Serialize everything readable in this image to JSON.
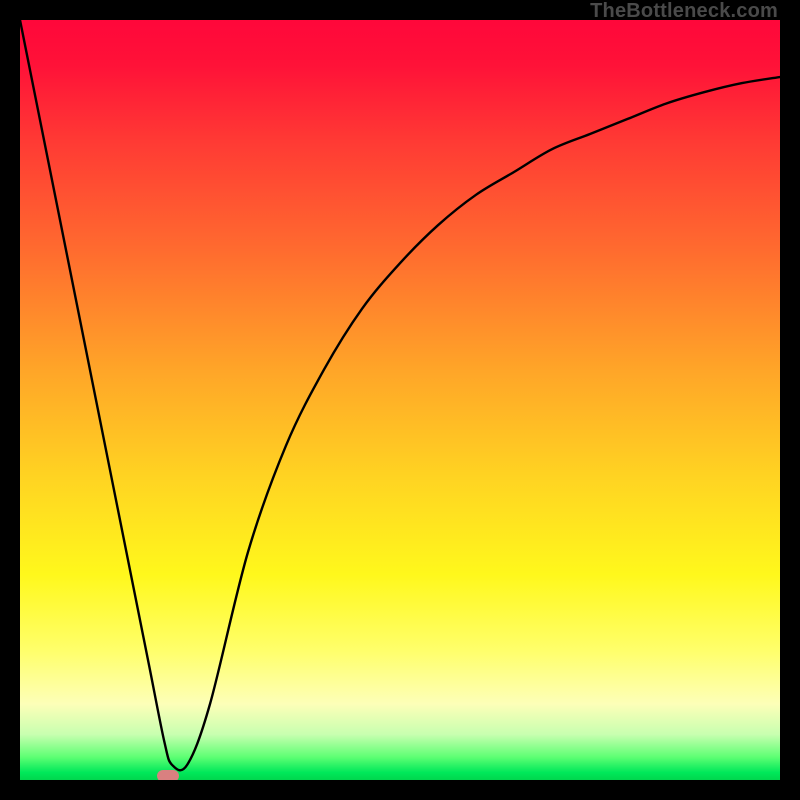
{
  "watermark": "TheBottleneck.com",
  "chart_data": {
    "type": "line",
    "title": "",
    "xlabel": "",
    "ylabel": "",
    "xlim": [
      0,
      100
    ],
    "ylim": [
      0,
      100
    ],
    "grid": false,
    "legend": false,
    "series": [
      {
        "name": "curve",
        "x": [
          0,
          5,
          10,
          15,
          17,
          19,
          20,
          22,
          25,
          30,
          35,
          40,
          45,
          50,
          55,
          60,
          65,
          70,
          75,
          80,
          85,
          90,
          95,
          100
        ],
        "y": [
          100,
          75,
          50,
          25,
          15,
          5,
          2,
          2,
          10,
          30,
          44,
          54,
          62,
          68,
          73,
          77,
          80,
          83,
          85,
          87,
          89,
          90.5,
          91.7,
          92.5
        ]
      }
    ],
    "marker": {
      "x_pct": 19.5,
      "y_pct": 0.5
    },
    "background": {
      "type": "vertical-gradient",
      "stops": [
        {
          "pct": 0,
          "color": "#ff073a"
        },
        {
          "pct": 30,
          "color": "#ff6a2f"
        },
        {
          "pct": 60,
          "color": "#ffd322"
        },
        {
          "pct": 90,
          "color": "#fdffb8"
        },
        {
          "pct": 100,
          "color": "#00d64d"
        }
      ]
    }
  }
}
